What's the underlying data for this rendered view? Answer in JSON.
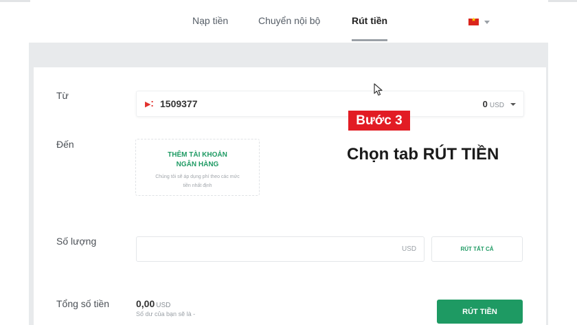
{
  "header": {
    "tabs": [
      {
        "label": "Nạp tiền"
      },
      {
        "label": "Chuyển nội bộ"
      },
      {
        "label": "Rút tiền"
      }
    ],
    "active_tab": "Rút tiền",
    "language_icon": "vietnam-flag-icon"
  },
  "form": {
    "from_label": "Từ",
    "to_label": "Đến",
    "quantity_label": "Số lượng",
    "total_label": "Tổng số tiền",
    "account": {
      "icon": "exness-logo-icon",
      "number": "1509377",
      "balance": "0",
      "currency": "USD"
    },
    "add_bank": {
      "title": "THÊM TÀI KHOẢN NGÂN HÀNG",
      "note": "Chúng tôi sẽ áp dụng phí theo các mức tiền nhất định"
    },
    "quantity": {
      "value": "",
      "currency": "USD",
      "withdraw_all_label": "RÚT TẤT CẢ"
    },
    "total": {
      "value": "0,00",
      "currency": "USD",
      "note": "Số dư của bạn sẽ là -"
    },
    "submit_label": "RÚT TIỀN"
  },
  "overlay": {
    "step_label": "Bước 3",
    "caption": "Chọn tab RÚT TIỀN"
  },
  "colors": {
    "accent_green": "#1e9a63",
    "step_red": "#e21c24",
    "band_grey": "#e8eaec"
  }
}
